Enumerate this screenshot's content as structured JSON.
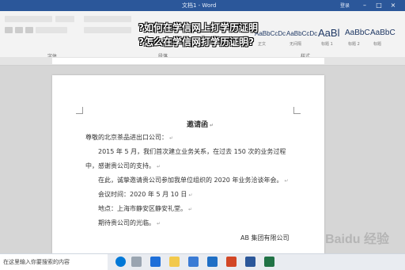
{
  "window": {
    "title": "文档1 - Word",
    "user": "登录"
  },
  "ribbon": {
    "groups": [
      "字体",
      "段落",
      "样式"
    ],
    "styles": [
      {
        "preview": "AaBbCcDc",
        "name": "正文"
      },
      {
        "preview": "AaBbCcDc",
        "name": "无间隔"
      },
      {
        "preview": "AaBl",
        "name": "标题 1"
      },
      {
        "preview": "AaBbC",
        "name": "标题 2"
      },
      {
        "preview": "AaBbC",
        "name": "标题"
      },
      {
        "preview": "AaBbC",
        "name": "副标题"
      }
    ]
  },
  "overlay": {
    "line1": "?如何在学信网上打学历证明",
    "line2": "?怎么在学信网打学历证明?"
  },
  "document": {
    "title": "邀请函",
    "salutation": "尊敬的北京茶品进出口公司：",
    "p1a": "2015 年 5 月，我们首次建立业务关系，在过去 150 次的业务过程",
    "p1b": "中，感谢贵公司的支持。",
    "p2": "在此，诚挚邀请贵公司参加我单位组织的 2020 年业务洽谈年会。",
    "time": "会议时间：2020 年 5 月 10 日",
    "place": "地点：上海市静安区静安礼堂。",
    "closing": "期待贵公司的光临。",
    "signature": "AB 集团有限公司"
  },
  "taskbar": {
    "search_placeholder": "在这里输入你要搜索的内容"
  },
  "watermark": "Baidu 经验"
}
